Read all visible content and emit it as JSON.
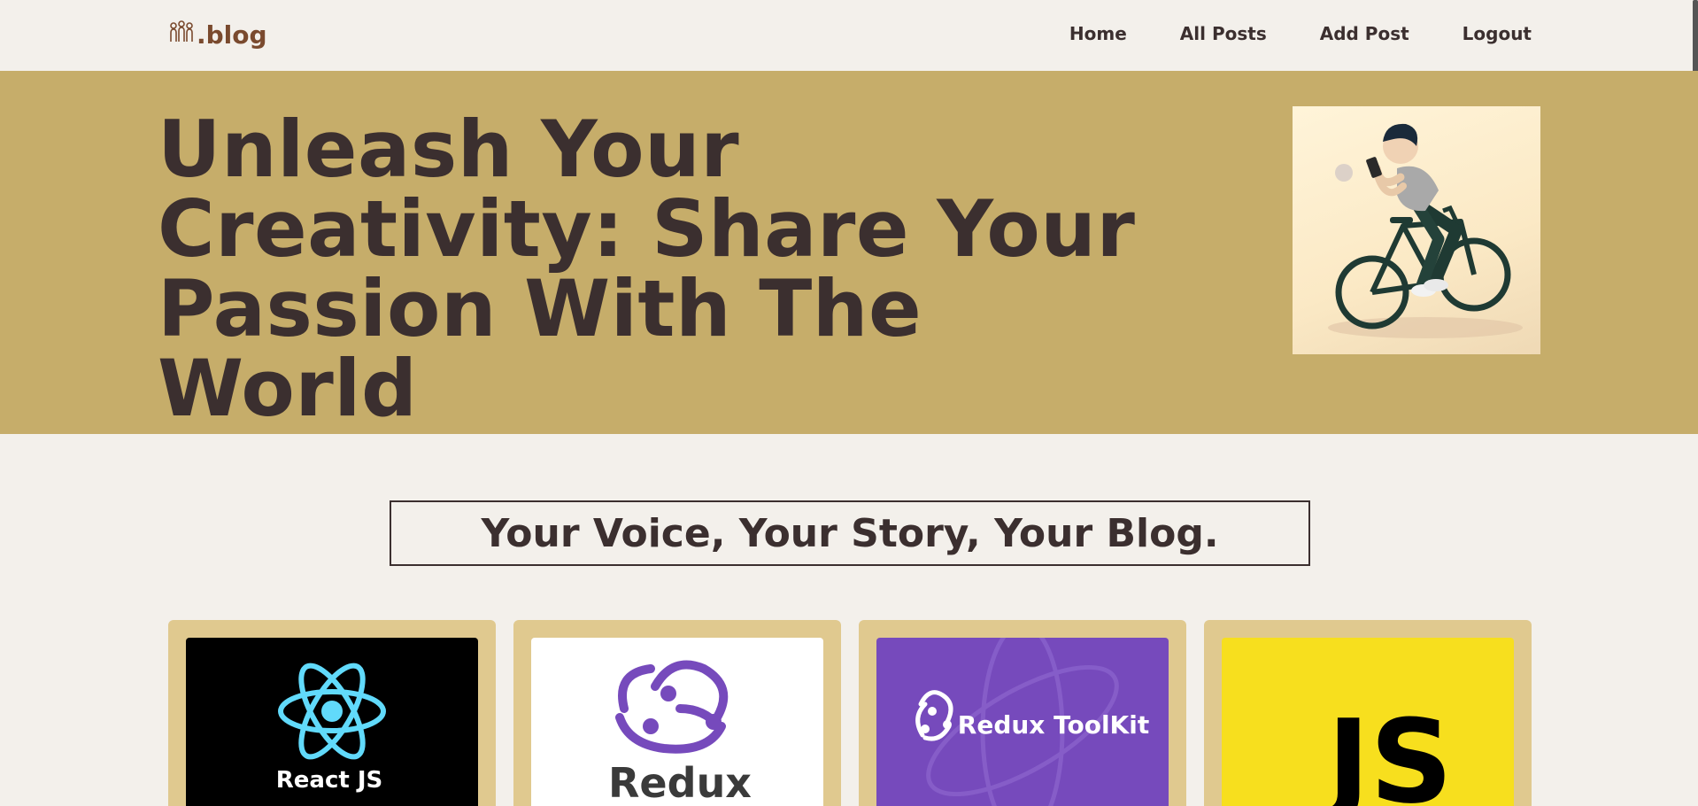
{
  "nav": {
    "logo_text": ".blog",
    "links": [
      "Home",
      "All Posts",
      "Add Post",
      "Logout"
    ]
  },
  "hero": {
    "title": "Unleash Your Creativity: Share Your Passion With The World",
    "image_icon": "cyclist-illustration"
  },
  "tagline": "Your Voice, Your Story, Your Blog.",
  "cards": [
    {
      "label": "React JS",
      "background": "#000000",
      "icon": "react-logo-icon"
    },
    {
      "label": "Redux",
      "background": "#ffffff",
      "icon": "redux-logo-icon"
    },
    {
      "label": "Redux ToolKit",
      "background": "#764abc",
      "icon": "redux-toolkit-logo-icon"
    },
    {
      "label": "JS",
      "background": "#f7df1e",
      "icon": "js-logo-icon"
    }
  ],
  "colors": {
    "page_bg": "#f3f0eb",
    "hero_bg": "#c6ad6a",
    "card_bg": "#e0c98f",
    "text": "#3b2f2f",
    "logo": "#7a4a2e"
  }
}
